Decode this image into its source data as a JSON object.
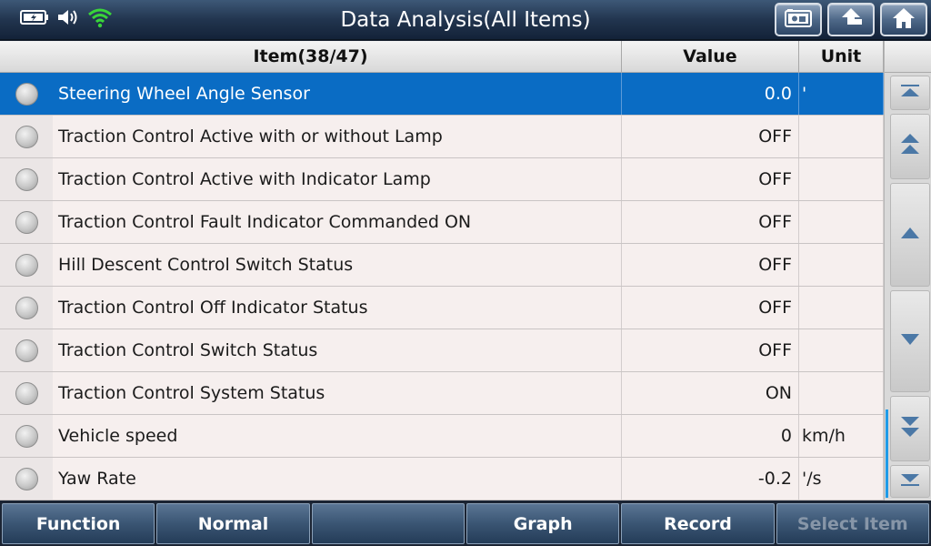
{
  "header": {
    "title": "Data Analysis(All Items)",
    "status_icons": [
      "battery-charging-icon",
      "speaker-icon",
      "wifi-icon"
    ],
    "buttons": [
      "screenshot-icon",
      "back-icon",
      "home-icon"
    ]
  },
  "table": {
    "headers": {
      "item": "Item(38/47)",
      "value": "Value",
      "unit": "Unit"
    },
    "rows": [
      {
        "item": "Steering Wheel Angle Sensor",
        "value": "0.0",
        "unit": "'"
      },
      {
        "item": "Traction Control Active with or without Lamp",
        "value": "OFF",
        "unit": ""
      },
      {
        "item": "Traction Control Active with Indicator Lamp",
        "value": "OFF",
        "unit": ""
      },
      {
        "item": "Traction Control Fault Indicator Commanded ON",
        "value": "OFF",
        "unit": ""
      },
      {
        "item": "Hill Descent Control Switch Status",
        "value": "OFF",
        "unit": ""
      },
      {
        "item": "Traction Control Off Indicator Status",
        "value": "OFF",
        "unit": ""
      },
      {
        "item": "Traction Control Switch Status",
        "value": "OFF",
        "unit": ""
      },
      {
        "item": "Traction Control System Status",
        "value": "ON",
        "unit": ""
      },
      {
        "item": "Vehicle speed",
        "value": "0",
        "unit": "km/h"
      },
      {
        "item": "Yaw Rate",
        "value": "-0.2",
        "unit": "'/s"
      }
    ]
  },
  "footer": {
    "function": "Function",
    "normal": "Normal",
    "empty": "",
    "graph": "Graph",
    "record": "Record",
    "select_item": "Select Item"
  },
  "colors": {
    "selected_row": "#0a6cc4",
    "header_bar": "#22354f",
    "scroll_indicator": "#1e9be8"
  }
}
